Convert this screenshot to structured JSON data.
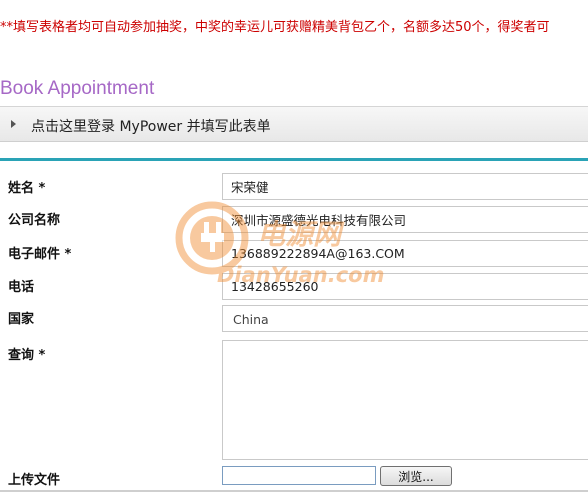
{
  "notice": "**填写表格者均可自动参加抽奖，中奖的幸运儿可获赠精美背包乙个，名额多达50个，得奖者可",
  "page_title": "Book Appointment",
  "login_bar": {
    "label": "点击这里登录 MyPower 并填写此表单"
  },
  "form": {
    "name": {
      "label": "姓名 *",
      "value": "宋荣健"
    },
    "company": {
      "label": "公司名称",
      "value": "深圳市源盛德光电科技有限公司"
    },
    "email": {
      "label": "电子邮件 *",
      "value": "136889222894A@163.COM"
    },
    "phone": {
      "label": "电话",
      "value": "13428655260"
    },
    "country": {
      "label": "国家",
      "value": "China"
    },
    "inquiry": {
      "label": "查询 *",
      "value": ""
    },
    "upload": {
      "label": "上传文件",
      "button_label": "浏览..."
    }
  },
  "watermark": {
    "text_cn": "电源网",
    "text_en": "DianYuan.com"
  },
  "colors": {
    "notice": "#cc0000",
    "title": "#a668c6",
    "accent_line": "#2aa3b6",
    "watermark": "#f08a2c"
  }
}
